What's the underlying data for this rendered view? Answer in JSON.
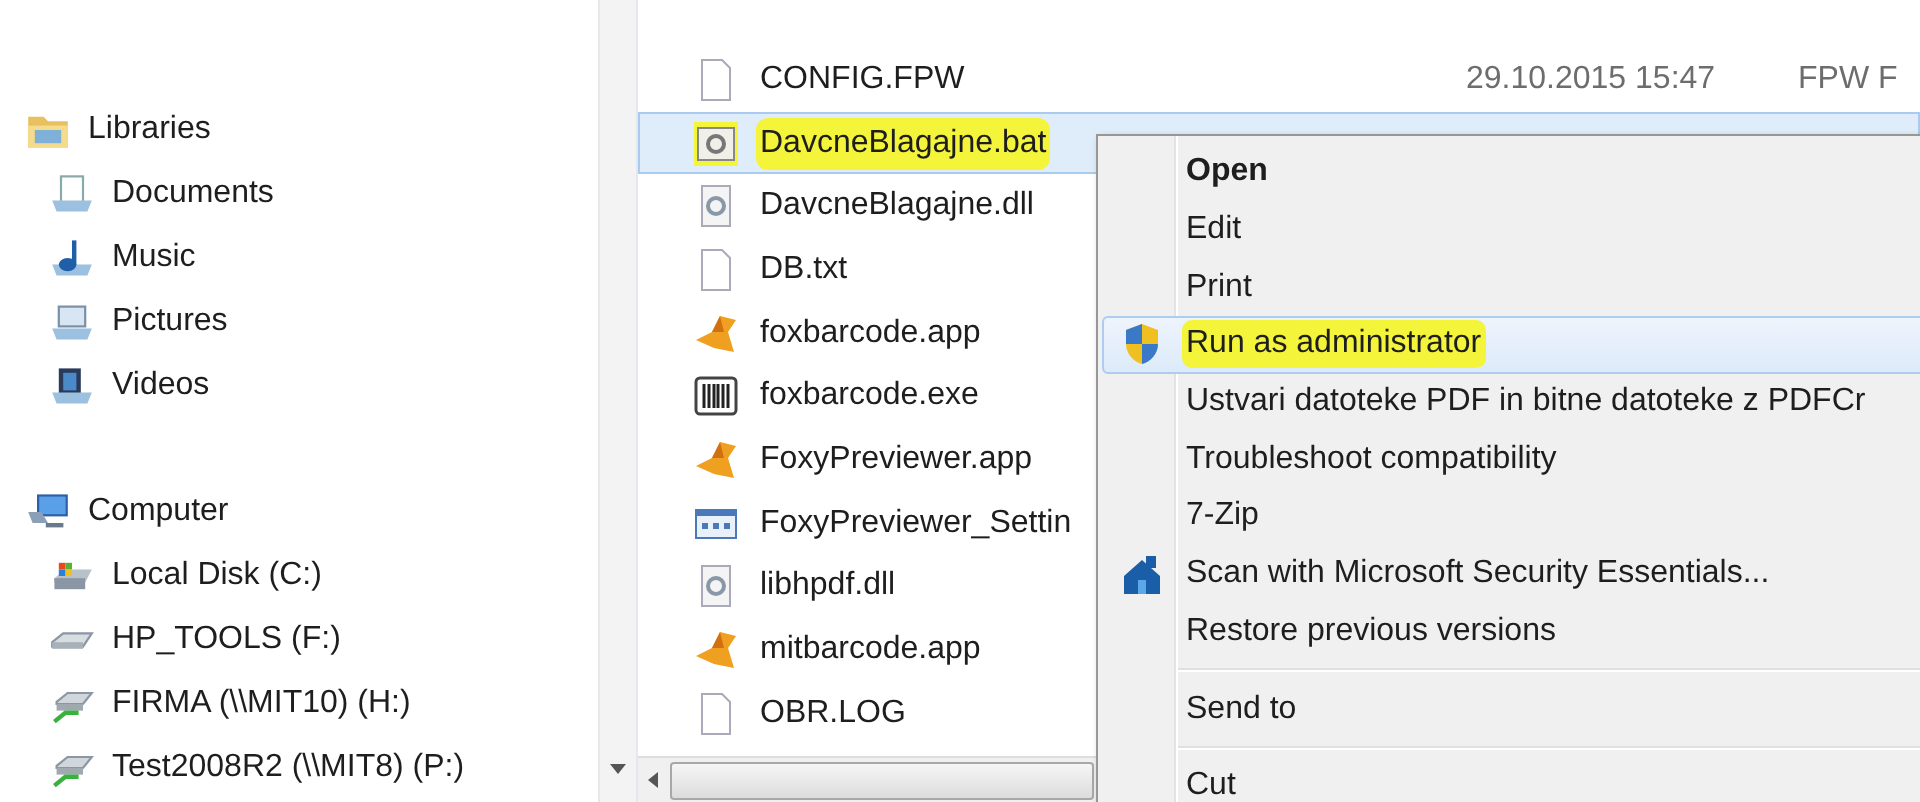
{
  "sidebar": {
    "groups": [
      {
        "label": "Libraries",
        "kind": "library",
        "children": [
          {
            "label": "Documents",
            "kind": "documents"
          },
          {
            "label": "Music",
            "kind": "music"
          },
          {
            "label": "Pictures",
            "kind": "pictures"
          },
          {
            "label": "Videos",
            "kind": "videos"
          }
        ]
      },
      {
        "label": "Computer",
        "kind": "computer",
        "children": [
          {
            "label": "Local Disk (C:)",
            "kind": "disk"
          },
          {
            "label": "HP_TOOLS (F:)",
            "kind": "drive"
          },
          {
            "label": "FIRMA (\\\\MIT10) (H:)",
            "kind": "network"
          },
          {
            "label": "Test2008R2 (\\\\MIT8) (P:)",
            "kind": "network"
          }
        ]
      }
    ]
  },
  "files": [
    {
      "name": "CONFIG.FPW",
      "kind": "doc",
      "date": "29.10.2015 15:47",
      "type": "FPW F",
      "selected": false,
      "marked": false
    },
    {
      "name": "DavcneBlagajne.bat",
      "kind": "bat",
      "selected": true,
      "marked": true
    },
    {
      "name": "DavcneBlagajne.dll",
      "kind": "dll",
      "selected": false,
      "marked": false
    },
    {
      "name": "DB.txt",
      "kind": "doc",
      "selected": false,
      "marked": false
    },
    {
      "name": "foxbarcode.app",
      "kind": "fox",
      "selected": false,
      "marked": false
    },
    {
      "name": "foxbarcode.exe",
      "kind": "barcode",
      "selected": false,
      "marked": false
    },
    {
      "name": "FoxyPreviewer.app",
      "kind": "fox",
      "selected": false,
      "marked": false
    },
    {
      "name": "FoxyPreviewer_Settin",
      "kind": "grid",
      "selected": false,
      "marked": false
    },
    {
      "name": "libhpdf.dll",
      "kind": "dll",
      "selected": false,
      "marked": false
    },
    {
      "name": "mitbarcode.app",
      "kind": "fox",
      "selected": false,
      "marked": false
    },
    {
      "name": "OBR.LOG",
      "kind": "doc",
      "selected": false,
      "marked": false
    }
  ],
  "context_menu": [
    {
      "label": "Open",
      "kind": "item",
      "default": true,
      "selected": false,
      "marked": false
    },
    {
      "label": "Edit",
      "kind": "item",
      "default": false,
      "selected": false,
      "marked": false
    },
    {
      "label": "Print",
      "kind": "item",
      "default": false,
      "selected": false,
      "marked": false
    },
    {
      "label": "Run as administrator",
      "kind": "shield-item",
      "default": false,
      "selected": true,
      "marked": true
    },
    {
      "label": "Ustvari datoteke PDF in bitne datoteke z PDFCr",
      "kind": "item",
      "default": false,
      "selected": false,
      "marked": false
    },
    {
      "label": "Troubleshoot compatibility",
      "kind": "item",
      "default": false,
      "selected": false,
      "marked": false
    },
    {
      "label": "7-Zip",
      "kind": "item",
      "default": false,
      "selected": false,
      "marked": false
    },
    {
      "label": "Scan with Microsoft Security Essentials...",
      "kind": "scan-item",
      "default": false,
      "selected": false,
      "marked": false
    },
    {
      "label": "Restore previous versions",
      "kind": "item",
      "default": false,
      "selected": false,
      "marked": false
    },
    {
      "kind": "separator"
    },
    {
      "label": "Send to",
      "kind": "item",
      "default": false,
      "selected": false,
      "marked": false
    },
    {
      "kind": "separator"
    },
    {
      "label": "Cut",
      "kind": "item",
      "default": false,
      "selected": false,
      "marked": false
    }
  ]
}
